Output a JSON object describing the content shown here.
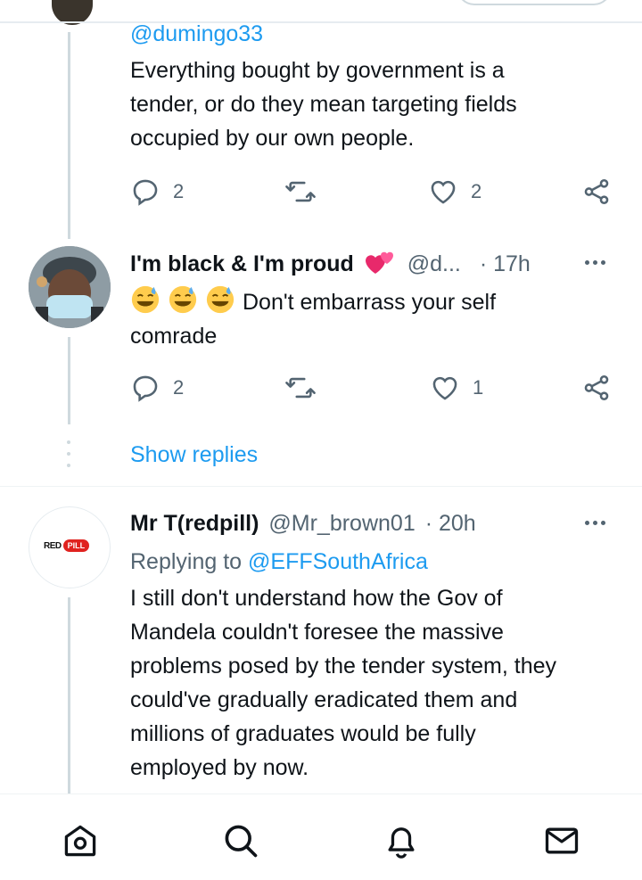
{
  "top_reply": {
    "handle": "@dumingo33",
    "text_lines": [
      "Everything bought by government is a",
      "tender, or do they mean targeting fields",
      "occupied by our own people."
    ],
    "reply_count": "2",
    "like_count": "2"
  },
  "reply_two": {
    "name": "I'm black & I'm proud",
    "handle": "@d...",
    "time": "· 17h",
    "text_line1": "Don't embarrass your self",
    "text_line2": "comrade",
    "reply_count": "2",
    "like_count": "1"
  },
  "show_replies": "Show replies",
  "reply_three": {
    "name": "Mr T(redpill)",
    "handle": "@Mr_brown01",
    "time": "· 20h",
    "replying_prefix": "Replying to",
    "replying_to": "@EFFSouthAfrica",
    "avatar_logo_left": "RED",
    "avatar_logo_right": "PILL",
    "text_lines": [
      "I still don't understand how the Gov of",
      "Mandela couldn't foresee the massive",
      "problems posed by the tender system, they",
      "could've gradually eradicated them and",
      "millions of graduates would be fully",
      "employed by now."
    ]
  },
  "bottom_nav": [
    "home-icon",
    "search-icon",
    "notifications-icon",
    "messages-icon"
  ],
  "colors": {
    "accent": "#1d9bf0",
    "muted": "#536471",
    "thread_line": "#cfd9de"
  }
}
